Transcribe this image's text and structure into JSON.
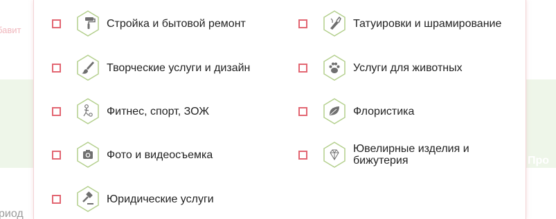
{
  "background": {
    "left_text": "бавит",
    "bottom_text": "риод",
    "right_text": "Про",
    "help_icon": "?"
  },
  "options": [
    {
      "label": "Стройка и бытовой ремонт",
      "icon": "paint-roller-icon",
      "checked": false
    },
    {
      "label": "Татуировки и шрамирование",
      "icon": "tattoo-icon",
      "checked": false
    },
    {
      "label": "Творческие услуги и дизайн",
      "icon": "paintbrush-icon",
      "checked": false
    },
    {
      "label": "Услуги для животных",
      "icon": "paw-icon",
      "checked": false
    },
    {
      "label": "Фитнес, спорт, ЗОЖ",
      "icon": "fitness-icon",
      "checked": false
    },
    {
      "label": "Флористика",
      "icon": "leaf-icon",
      "checked": false
    },
    {
      "label": "Фото и видеосъемка",
      "icon": "camera-icon",
      "checked": false
    },
    {
      "label": "Ювелирные изделия и бижутерия",
      "icon": "diamond-icon",
      "checked": false
    },
    {
      "label": "Юридические услуги",
      "icon": "gavel-icon",
      "checked": false
    }
  ],
  "colors": {
    "checkbox_border": "#e26571",
    "hex_outline": "#b3cf8c",
    "icon_fill": "#6f6f6f",
    "background_band": "#eef6e9"
  }
}
